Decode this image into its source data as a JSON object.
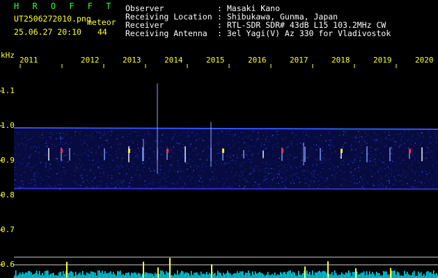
{
  "header": {
    "brand": "H R O F F T",
    "filename": "UT2506272010.png",
    "meteor_label": "meteor",
    "datetime": "25.06.27 20:10",
    "count": "44",
    "info": [
      {
        "label": "Observer",
        "value": ": Masaki Kano"
      },
      {
        "label": "Receiving Location",
        "value": ": Shibukawa, Gunma, Japan"
      },
      {
        "label": "Receiver",
        "value": ": RTL-SDR SDR# 43dB L15 103.2MHz CW"
      },
      {
        "label": "Receiving Antenna",
        "value": ": 3el Yagi(V) Az 330 for Vladivostok"
      }
    ]
  },
  "axis": {
    "unit": "kHz",
    "y_ticks": [
      "1.1",
      "1.0",
      "0.9",
      "0.8",
      "0.7",
      "0.6"
    ],
    "x_ticks": [
      "2011",
      "2012",
      "2013",
      "2014",
      "2015",
      "2016",
      "2017",
      "2018",
      "2019",
      "2020"
    ]
  },
  "colors": {
    "background": "#000000",
    "header_text": "#ffffff",
    "label_yellow": "#ffff33",
    "brand_green": "#33ff33",
    "noise_blue": "#2233cc",
    "spectrum_cyan": "#00ffff"
  }
}
